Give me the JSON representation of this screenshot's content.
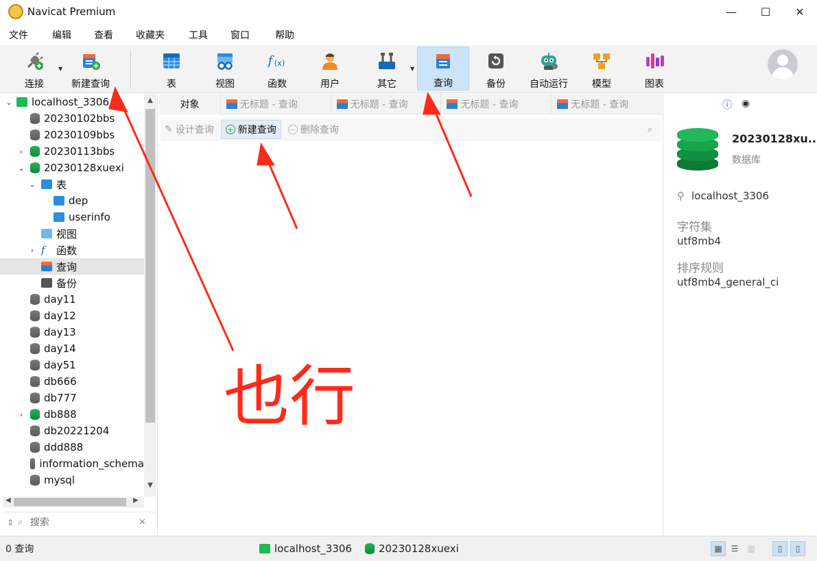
{
  "window": {
    "title": "Navicat Premium",
    "controls": [
      "—",
      "☐",
      "✕"
    ]
  },
  "menu": [
    "文件",
    "编辑",
    "查看",
    "收藏夹",
    "工具",
    "窗口",
    "帮助"
  ],
  "toolbar": {
    "connect": "连接",
    "new_query": "新建查询",
    "table": "表",
    "view": "视图",
    "function": "函数",
    "user": "用户",
    "other": "其它",
    "query": "查询",
    "backup": "备份",
    "automation": "自动运行",
    "model": "模型",
    "chart": "图表"
  },
  "tree": {
    "connection": "localhost_3306",
    "items": [
      {
        "label": "20230102bbs"
      },
      {
        "label": "20230109bbs"
      },
      {
        "label": "20230113bbs"
      },
      {
        "label": "20230128xuexi"
      },
      {
        "label": "表"
      },
      {
        "label": "dep"
      },
      {
        "label": "userinfo"
      },
      {
        "label": "视图"
      },
      {
        "label": "函数"
      },
      {
        "label": "查询"
      },
      {
        "label": "备份"
      },
      {
        "label": "day11"
      },
      {
        "label": "day12"
      },
      {
        "label": "day13"
      },
      {
        "label": "day14"
      },
      {
        "label": "day51"
      },
      {
        "label": "db666"
      },
      {
        "label": "db777"
      },
      {
        "label": "db888"
      },
      {
        "label": "db20221204"
      },
      {
        "label": "ddd888"
      },
      {
        "label": "information_schema"
      },
      {
        "label": "mysql"
      }
    ],
    "search_placeholder": "搜索"
  },
  "tabs": {
    "objects": "对象",
    "query_tabs": [
      "无标题 - 查询",
      "无标题 - 查询",
      "无标题 - 查询",
      "无标题 - 查询"
    ]
  },
  "subbar": {
    "design": "设计查询",
    "new": "新建查询",
    "delete": "删除查询"
  },
  "info": {
    "name": "20230128xu..",
    "type": "数据库",
    "connection": "localhost_3306",
    "charset_label": "字符集",
    "charset_value": "utf8mb4",
    "collation_label": "排序规则",
    "collation_value": "utf8mb4_general_ci"
  },
  "status": {
    "count": "0 查询",
    "connection": "localhost_3306",
    "database": "20230128xuexi"
  },
  "annotation": {
    "handwritten": "也行",
    "color": "#ff2a1a"
  }
}
